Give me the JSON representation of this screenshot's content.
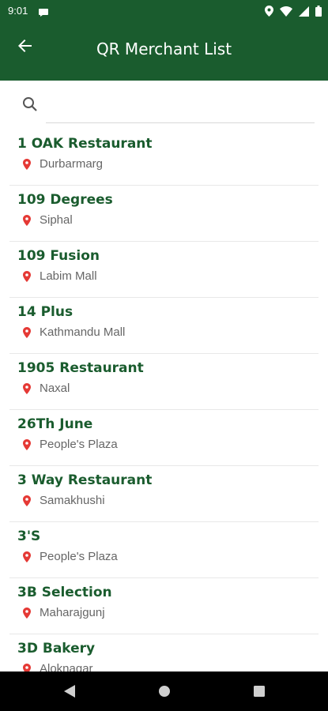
{
  "status_bar": {
    "time": "9:01"
  },
  "app_bar": {
    "title": "QR Merchant List"
  },
  "search": {
    "placeholder": "",
    "value": ""
  },
  "merchants": [
    {
      "name": "1 OAK Restaurant",
      "location": "Durbarmarg"
    },
    {
      "name": "109 Degrees",
      "location": "Siphal"
    },
    {
      "name": "109 Fusion",
      "location": "Labim Mall"
    },
    {
      "name": "14 Plus",
      "location": "Kathmandu Mall"
    },
    {
      "name": "1905 Restaurant",
      "location": "Naxal"
    },
    {
      "name": "26Th June",
      "location": "People's Plaza"
    },
    {
      "name": "3 Way Restaurant",
      "location": "Samakhushi"
    },
    {
      "name": "3'S",
      "location": "People's Plaza"
    },
    {
      "name": "3B Selection",
      "location": "Maharajgunj"
    },
    {
      "name": "3D Bakery",
      "location": "Aloknagar"
    }
  ],
  "colors": {
    "primary": "#1a5c2e",
    "pin": "#e53935",
    "location_text": "#666666"
  },
  "icons": {
    "back": "arrow-left-icon",
    "search": "search-icon",
    "pin": "location-pin-icon"
  }
}
